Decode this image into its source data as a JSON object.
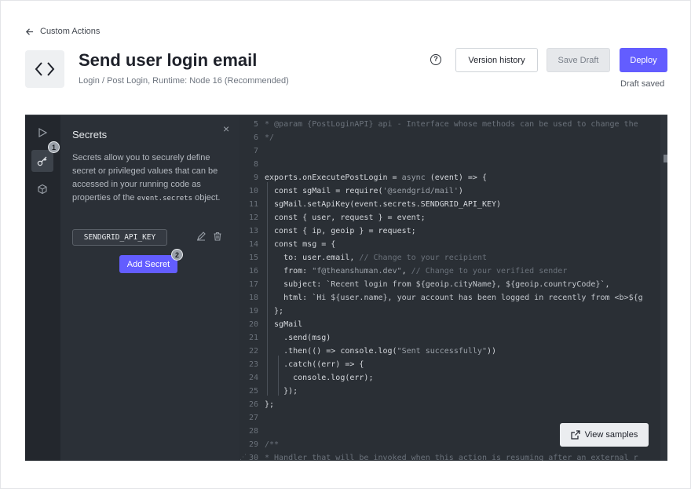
{
  "header": {
    "back_label": "Custom Actions",
    "title": "Send user login email",
    "subtitle": "Login / Post Login, Runtime: Node 16 (Recommended)",
    "help_glyph": "?",
    "version_history_label": "Version history",
    "save_draft_label": "Save Draft",
    "deploy_label": "Deploy",
    "draft_status": "Draft saved"
  },
  "rail": {
    "badge_1": "1",
    "icons": [
      "play-icon",
      "key-icon",
      "box-icon"
    ]
  },
  "secrets": {
    "title": "Secrets",
    "close_glyph": "×",
    "desc_before": "Secrets allow you to securely define secret or privileged values that can be accessed in your running code as properties of the ",
    "desc_code": "event.secrets",
    "desc_after": " object.",
    "items": [
      "SENDGRID_API_KEY"
    ],
    "add_label": "Add Secret",
    "badge_2": "2"
  },
  "code": {
    "lines": [
      {
        "n": "5",
        "text": "* @param {PostLoginAPI} api - Interface whose methods can be used to change the"
      },
      {
        "n": "6",
        "text": "*/"
      },
      {
        "n": "7",
        "text": ""
      },
      {
        "n": "8",
        "text": ""
      },
      {
        "n": "9",
        "text": "exports.onExecutePostLogin = async (event) => {"
      },
      {
        "n": "10",
        "text": "  const sgMail = require('@sendgrid/mail')"
      },
      {
        "n": "11",
        "text": "  sgMail.setApiKey(event.secrets.SENDGRID_API_KEY)"
      },
      {
        "n": "12",
        "text": "  const { user, request } = event;"
      },
      {
        "n": "13",
        "text": "  const { ip, geoip } = request;"
      },
      {
        "n": "14",
        "text": "  const msg = {"
      },
      {
        "n": "15",
        "text": "    to: user.email, // Change to your recipient"
      },
      {
        "n": "16",
        "text": "    from: \"f@theanshuman.dev\", // Change to your verified sender"
      },
      {
        "n": "17",
        "text": "    subject: `Recent login from ${geoip.cityName}, ${geoip.countryCode}`,"
      },
      {
        "n": "18",
        "text": "    html: `Hi ${user.name}, your account has been logged in recently from <b>${g"
      },
      {
        "n": "19",
        "text": "  };"
      },
      {
        "n": "20",
        "text": "  sgMail"
      },
      {
        "n": "21",
        "text": "    .send(msg)"
      },
      {
        "n": "22",
        "text": "    .then(() => console.log(\"Sent successfully\"))"
      },
      {
        "n": "23",
        "text": "    .catch((err) => {"
      },
      {
        "n": "24",
        "text": "      console.log(err);"
      },
      {
        "n": "25",
        "text": "    });"
      },
      {
        "n": "26",
        "text": "};"
      },
      {
        "n": "27",
        "text": ""
      },
      {
        "n": "28",
        "text": ""
      },
      {
        "n": "29",
        "text": "/**"
      },
      {
        "n": "30",
        "text": "* Handler that will be invoked when this action is resuming after an external r"
      }
    ]
  },
  "view_samples_label": "View samples",
  "colors": {
    "accent": "#635dff",
    "editor_bg": "#2a2f35",
    "panel_bg": "#2b3037"
  }
}
